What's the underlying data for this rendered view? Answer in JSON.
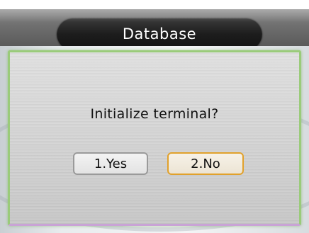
{
  "header": {
    "title": "Database"
  },
  "dialog": {
    "message": "Initialize terminal?",
    "buttons": [
      {
        "label": "1.Yes",
        "selected": false
      },
      {
        "label": "2.No",
        "selected": true
      }
    ]
  },
  "colors": {
    "selected_border": "#e1a12c",
    "dialog_border_top": "#9acb7a",
    "dialog_border_bottom": "#c9a3d6",
    "title_pill": "#1d1d1d"
  }
}
